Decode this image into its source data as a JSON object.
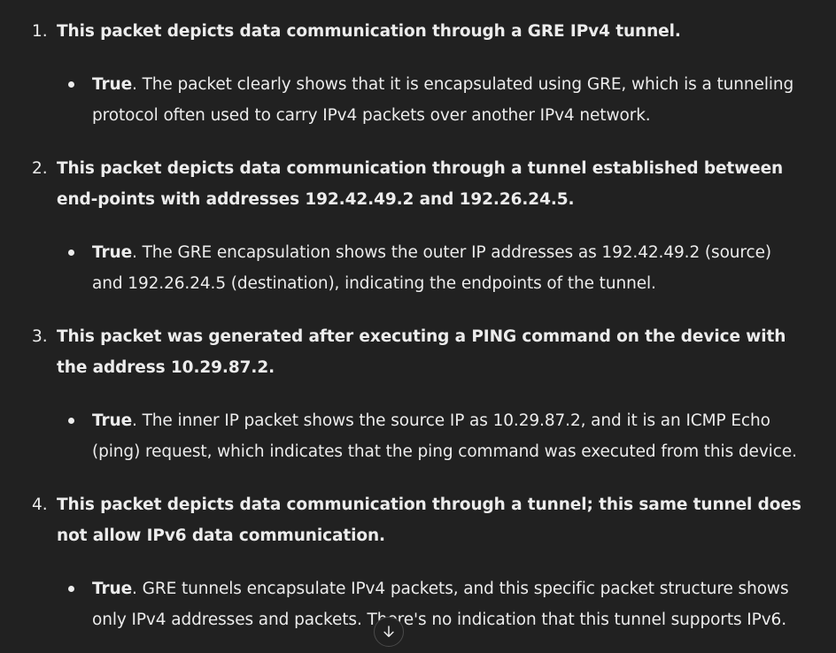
{
  "items": [
    {
      "number": "1.",
      "question": "This packet depicts data communication through a GRE IPv4 tunnel.",
      "verdict": "True",
      "explanation": ". The packet clearly shows that it is encapsulated using GRE, which is a tunneling protocol often used to carry IPv4 packets over another IPv4 network."
    },
    {
      "number": "2.",
      "question": "This packet depicts data communication through a tunnel established between end-points with addresses 192.42.49.2 and 192.26.24.5.",
      "verdict": "True",
      "explanation": ". The GRE encapsulation shows the outer IP addresses as 192.42.49.2 (source) and 192.26.24.5 (destination), indicating the endpoints of the tunnel."
    },
    {
      "number": "3.",
      "question": "This packet was generated after executing a PING command on the device with the address 10.29.87.2.",
      "verdict": "True",
      "explanation": ". The inner IP packet shows the source IP as 10.29.87.2, and it is an ICMP Echo (ping) request, which indicates that the ping command was executed from this device."
    },
    {
      "number": "4.",
      "question": "This packet depicts data communication through a tunnel; this same tunnel does not allow IPv6 data communication.",
      "verdict": "True",
      "explanation": ". GRE tunnels encapsulate IPv4 packets, and this specific packet structure shows only IPv4 addresses and packets. There's no indication that this tunnel supports IPv6."
    }
  ],
  "scroll_button": {
    "icon": "arrow-down-icon"
  },
  "colors": {
    "background": "#212121",
    "text": "#ececec"
  }
}
